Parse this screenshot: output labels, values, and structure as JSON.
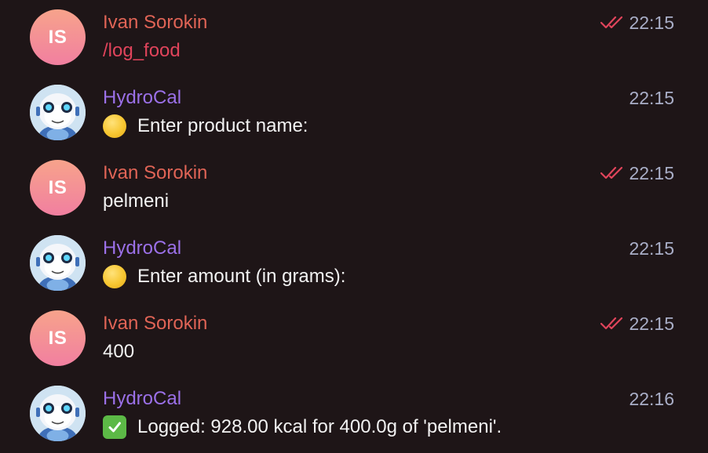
{
  "chat": {
    "messages": [
      {
        "sender": "Ivan Sorokin",
        "initials": "IS",
        "text": "/log_food",
        "time": "22:15",
        "type": "user",
        "read": true
      },
      {
        "sender": "HydroCal",
        "text": "Enter product name:",
        "emoji": "yellow-circle",
        "time": "22:15",
        "type": "bot"
      },
      {
        "sender": "Ivan Sorokin",
        "initials": "IS",
        "text": "pelmeni",
        "time": "22:15",
        "type": "user",
        "read": true
      },
      {
        "sender": "HydroCal",
        "text": "Enter amount (in grams):",
        "emoji": "yellow-circle",
        "time": "22:15",
        "type": "bot"
      },
      {
        "sender": "Ivan Sorokin",
        "initials": "IS",
        "text": "400",
        "time": "22:15",
        "type": "user",
        "read": true
      },
      {
        "sender": "HydroCal",
        "text": "Logged: 928.00 kcal for 400.0g of 'pelmeni'.",
        "emoji": "check-mark",
        "time": "22:16",
        "type": "bot"
      }
    ]
  },
  "colors": {
    "background": "#1e1517",
    "user_name": "#e06456",
    "bot_name": "#9b70e8",
    "command": "#e0445b",
    "time": "#a9aec7",
    "read_checks": "#e0445b"
  }
}
